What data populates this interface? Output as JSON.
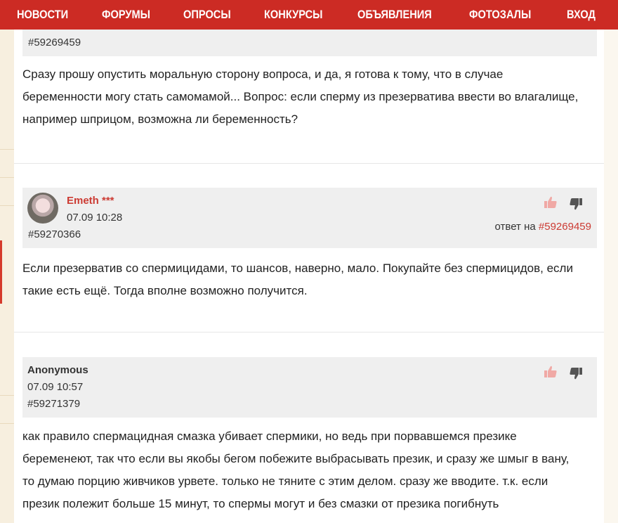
{
  "nav": {
    "items": [
      "НОВОСТИ",
      "ФОРУМЫ",
      "ОПРОСЫ",
      "КОНКУРСЫ",
      "ОБЪЯВЛЕНИЯ",
      "ФОТОЗАЛЫ",
      "ВХОД"
    ],
    "menu_icon": "hamburger-menu-icon"
  },
  "colors": {
    "brand": "#cc2b24",
    "author_red": "#cc3b33",
    "header_bg": "#efefef"
  },
  "posts": [
    {
      "id": "#59269459",
      "body": "Сразу прошу опустить моральную сторону вопроса, и да, я готова к тому, что в случае беременности могу стать самомамой... Вопрос: если сперму из презерватива ввести во влагалище, например шприцом, возможна ли беременность?"
    },
    {
      "author": "Emeth ***",
      "date": "07.09 10:28",
      "id": "#59270366",
      "reply_prefix": "ответ на",
      "reply_to": "#59269459",
      "body": "Если презерватив со спермицидами, то шансов, наверно, мало. Покупайте без спермицидов, если такие есть ещё. Тогда вполне возможно получится."
    },
    {
      "author": "Anonymous",
      "date": "07.09 10:57",
      "id": "#59271379",
      "body": "как правило спермацидная смазка убивает спермики, но ведь при порвавшемся презике беременеют, так что если вы якобы бегом побежите выбрасывать презик, и сразу же шмыг в вану, то думаю порцию живчиков урвете. только не тяните с этим делом. сразу же вводите. т.к. если презик полежит больше 15 минут, то спермы могут и без смазки от презика погибнуть"
    }
  ]
}
